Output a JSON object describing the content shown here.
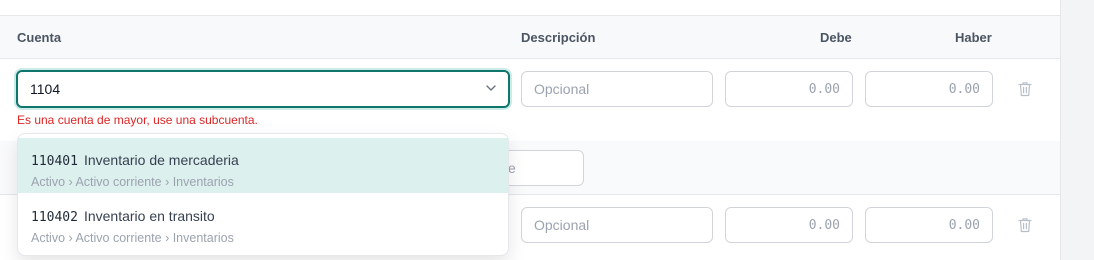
{
  "table": {
    "headers": {
      "account": "Cuenta",
      "description": "Descripción",
      "debit": "Debe",
      "credit": "Haber"
    }
  },
  "row1": {
    "account_value": "1104",
    "description_placeholder": "Opcional",
    "debit_value": "0.00",
    "credit_value": "0.00",
    "error": "Es una cuenta de mayor, use una subcuenta."
  },
  "row2": {
    "partial_text": "e"
  },
  "row3": {
    "description_placeholder": "Opcional",
    "debit_value": "0.00",
    "credit_value": "0.00"
  },
  "dropdown": {
    "options": [
      {
        "code": "110401",
        "name": "Inventario de mercaderia",
        "path": "Activo › Activo corriente › Inventarios"
      },
      {
        "code": "110402",
        "name": "Inventario en transito",
        "path": "Activo › Activo corriente › Inventarios"
      }
    ]
  },
  "colors": {
    "accent": "#0f766e",
    "highlight": "#dcf0ee",
    "error": "#dc2626"
  },
  "icons": [
    "chevron-down-icon",
    "trash-icon"
  ]
}
